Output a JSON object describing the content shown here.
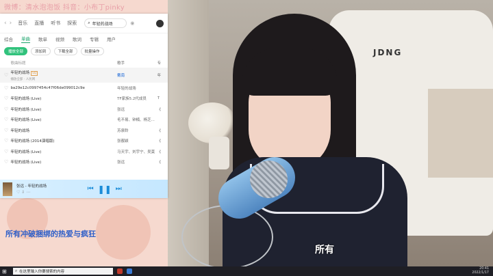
{
  "overlay": {
    "social_text": "微博：清水泡泡饭    抖音：小布丁pinky",
    "left_subtitle": "所有冲破捆绑的热爱与疯狂",
    "video_subtitle": "所有"
  },
  "video": {
    "chair_logo": "JDNG"
  },
  "player": {
    "nav": {
      "back": "‹",
      "forward": "›",
      "tabs": [
        "音乐",
        "直播",
        "听书",
        "探索"
      ],
      "search_value": "年轻的战场"
    },
    "subtabs": [
      "综合",
      "单曲",
      "歌单",
      "视频",
      "歌词",
      "专辑",
      "用户"
    ],
    "active_subtab": "单曲",
    "actions": {
      "play_all": "播放全部",
      "add_to": "添加到",
      "download": "下载全部",
      "batch": "批量操作"
    },
    "table_header": {
      "song": "歌曲标题",
      "singer": "歌手",
      "album": "专"
    },
    "rows": [
      {
        "name": "年轻的战场",
        "singer": "戴南",
        "album": "年",
        "sub": "播放全部 · 人民网"
      },
      {
        "name": "ba29e12c0997454c47f06de099012c9e",
        "singer": "年轻的战场",
        "album": "",
        "sub": ""
      },
      {
        "name": "年轻的战场 (Live)",
        "singer": "TF家族5.2代成员",
        "album": "T",
        "sub": ""
      },
      {
        "name": "年轻的战场 (Live)",
        "singer": "张远",
        "album": "《",
        "sub": ""
      },
      {
        "name": "年轻的战场 (Live)",
        "singer": "毛不易、钟楠、杨芝...",
        "album": "",
        "sub": ""
      },
      {
        "name": "年轻的战场",
        "singer": "苏泉聆",
        "album": "《",
        "sub": ""
      },
      {
        "name": "年轻的战场 (2014演唱版)",
        "singer": "张靓颖",
        "album": "《",
        "sub": ""
      },
      {
        "name": "年轻的战场 (Live)",
        "singer": "马天宇、刘宇宁、吴莫",
        "album": "《",
        "sub": ""
      },
      {
        "name": "年轻的战场 (Live)",
        "singer": "张远",
        "album": "《",
        "sub": ""
      }
    ],
    "mini_player": {
      "now_playing": "张远 - 年轻的战场",
      "prev": "⏮",
      "play": "❚❚",
      "next": "⏭"
    }
  },
  "taskbar": {
    "search_placeholder": "在这里输入你要搜索的内容",
    "time": "20:41",
    "date": "2022/1/17"
  }
}
